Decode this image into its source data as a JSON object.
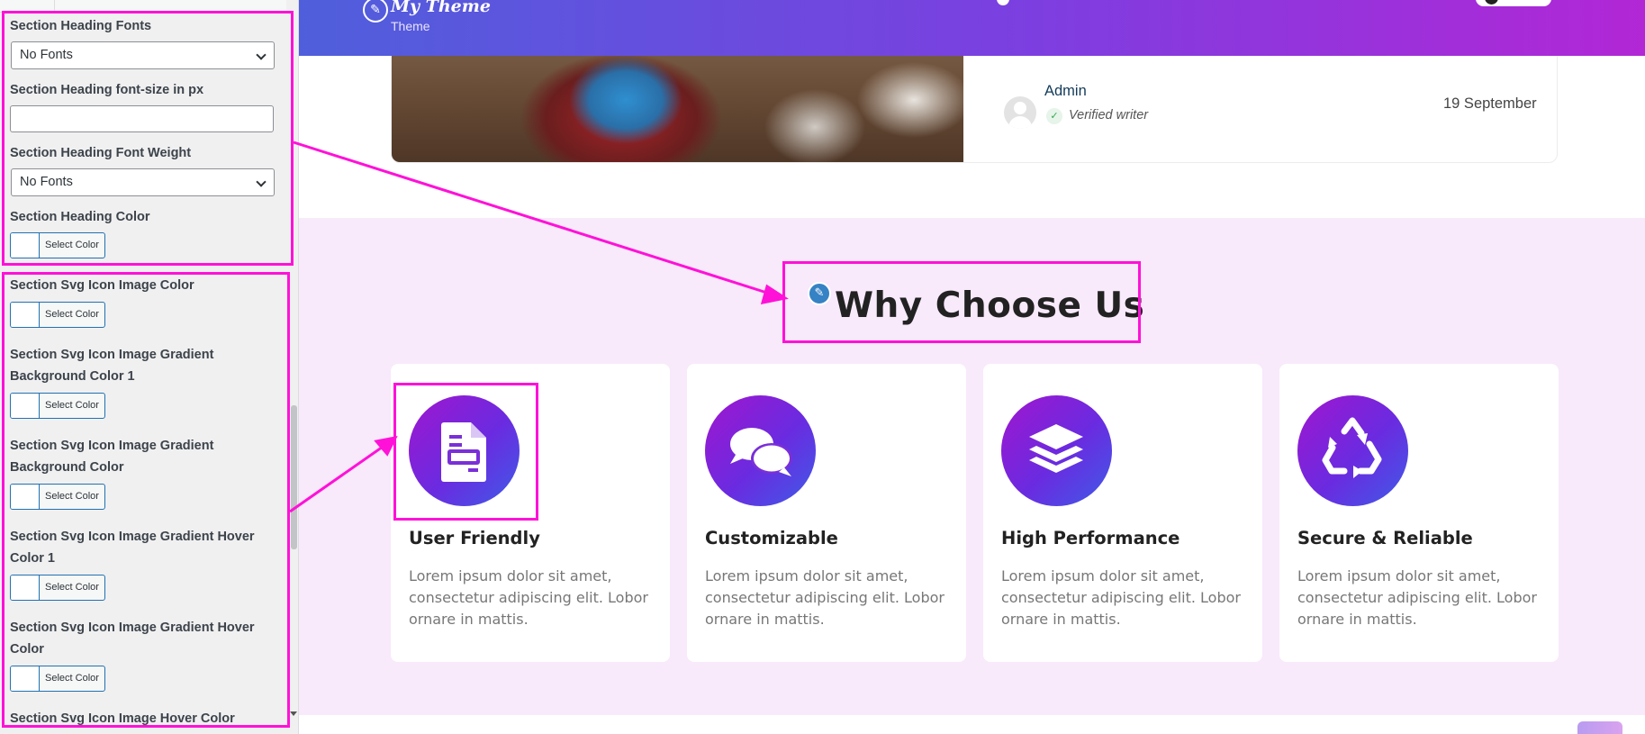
{
  "panel": {
    "heading_fonts_label": "Section Heading Fonts",
    "heading_fonts_value": "No Fonts",
    "heading_size_label": "Section Heading font-size in px",
    "heading_size_value": "",
    "heading_weight_label": "Section Heading Font Weight",
    "heading_weight_value": "No Fonts",
    "heading_color_label": "Section Heading Color",
    "svg_icon_color_label": "Section Svg Icon Image Color",
    "svg_grad_bg1_label_1": "Section Svg Icon Image Gradient",
    "svg_grad_bg1_label_2": "Background Color 1",
    "svg_grad_bg_label_1": "Section Svg Icon Image Gradient",
    "svg_grad_bg_label_2": "Background Color",
    "svg_grad_hover1_label_1": "Section Svg Icon Image Gradient Hover",
    "svg_grad_hover1_label_2": "Color 1",
    "svg_grad_hover_label_1": "Section Svg Icon Image Gradient Hover",
    "svg_grad_hover_label_2": "Color",
    "svg_hover_color_label": "Section Svg Icon Image Hover Color",
    "select_color": "Select Color"
  },
  "header": {
    "site_title": "My Theme",
    "site_tagline": "Theme"
  },
  "post": {
    "author": "Admin",
    "verified": "Verified writer",
    "date": "19 September"
  },
  "why": {
    "title": "Why Choose Us",
    "features": [
      {
        "title": "User Friendly",
        "desc": "Lorem ipsum dolor sit amet, consectetur adipiscing elit. Lobor ornare in mattis.",
        "icon": "document-icon"
      },
      {
        "title": "Customizable",
        "desc": "Lorem ipsum dolor sit amet, consectetur adipiscing elit. Lobor ornare in mattis.",
        "icon": "chat-bubbles-icon"
      },
      {
        "title": "High Performance",
        "desc": "Lorem ipsum dolor sit amet, consectetur adipiscing elit. Lobor ornare in mattis.",
        "icon": "layers-icon"
      },
      {
        "title": "Secure & Reliable",
        "desc": "Lorem ipsum dolor sit amet, consectetur adipiscing elit. Lobor ornare in mattis.",
        "icon": "recycle-icon"
      }
    ]
  },
  "colors": {
    "annotation": "#ff11d8",
    "header_gradient_start": "#4f5fdc",
    "header_gradient_end": "#b227d6",
    "icon_gradient_start": "#a016cf",
    "icon_gradient_end": "#3f5be8",
    "section_background": "#f8e9fb",
    "wp_button_border": "#2271b1"
  }
}
